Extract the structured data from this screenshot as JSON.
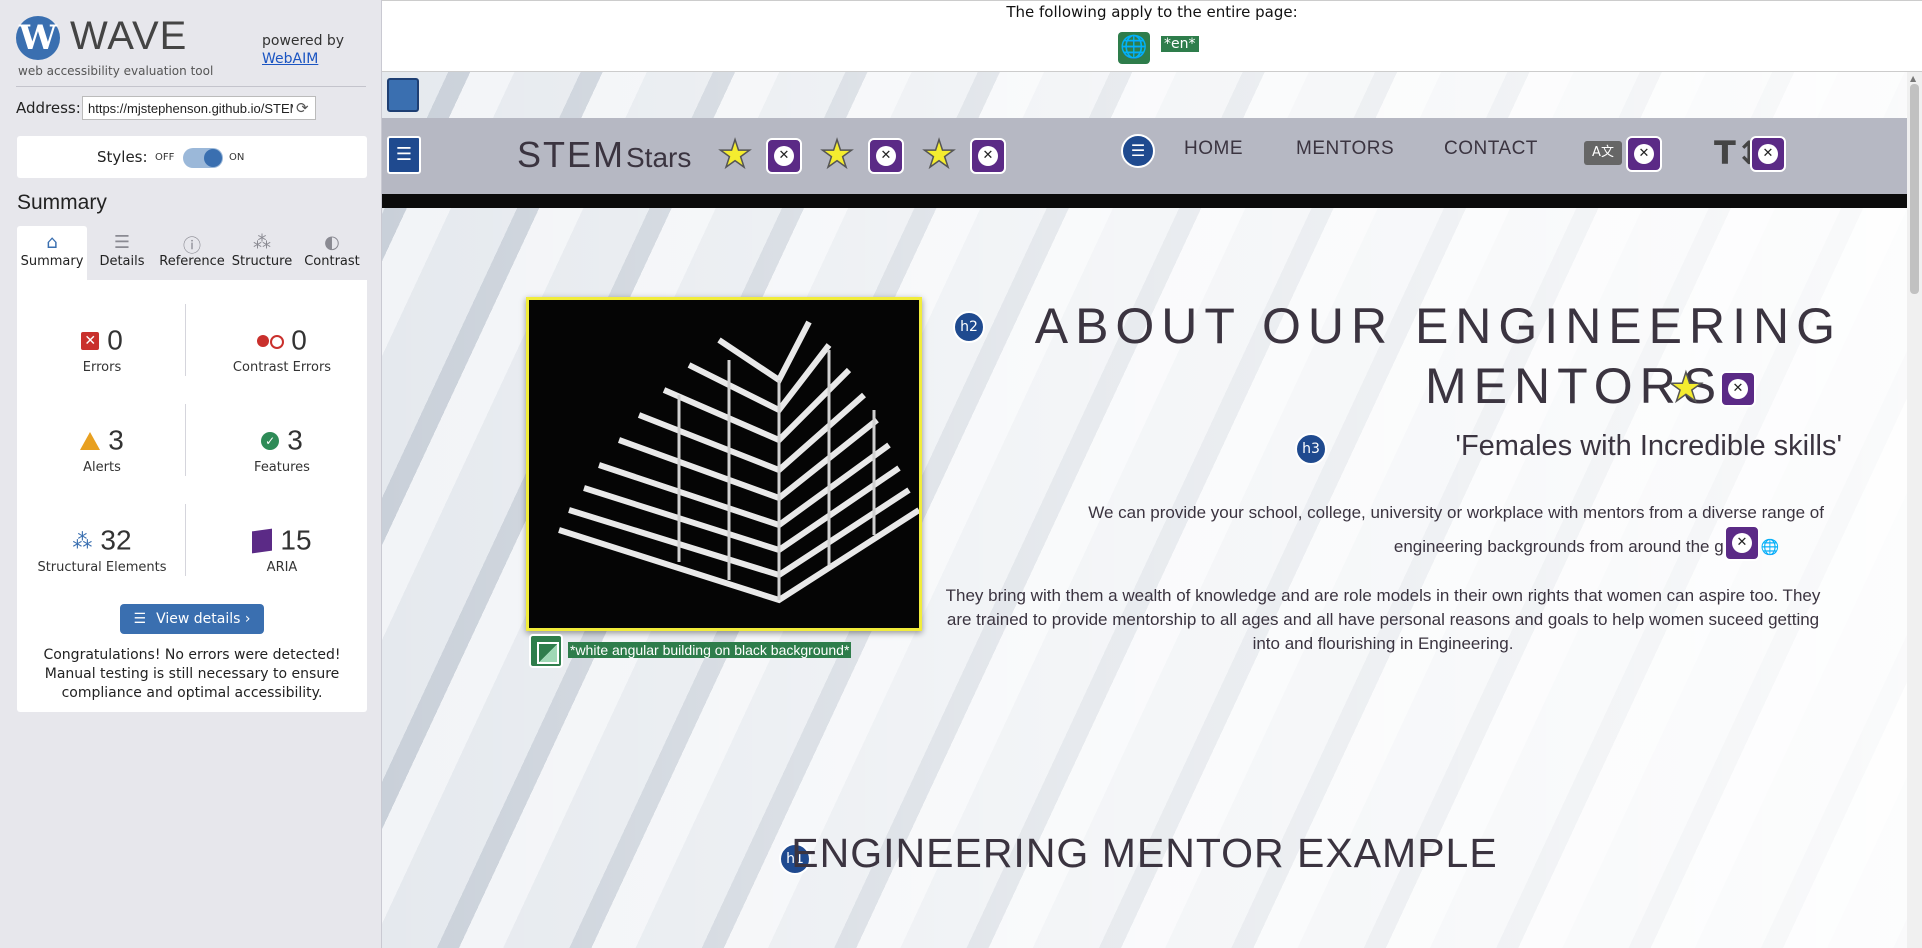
{
  "wave": {
    "logo_letter": "W",
    "title": "WAVE",
    "tagline": "web accessibility evaluation tool",
    "powered_by": "powered by",
    "powered_link": "WebAIM"
  },
  "address": {
    "label": "Address:",
    "value": "https://mjstephenson.github.io/STEM-Stars"
  },
  "styles": {
    "label": "Styles:",
    "off": "OFF",
    "on": "ON",
    "enabled": true
  },
  "summary_heading": "Summary",
  "tabs": [
    {
      "label": "Summary",
      "icon": "home-icon",
      "active": true
    },
    {
      "label": "Details",
      "icon": "list-icon"
    },
    {
      "label": "Reference",
      "icon": "info-icon"
    },
    {
      "label": "Structure",
      "icon": "structure-icon"
    },
    {
      "label": "Contrast",
      "icon": "contrast-icon"
    }
  ],
  "metrics": {
    "errors": {
      "value": "0",
      "label": "Errors"
    },
    "contrast_errors": {
      "value": "0",
      "label": "Contrast Errors"
    },
    "alerts": {
      "value": "3",
      "label": "Alerts"
    },
    "features": {
      "value": "3",
      "label": "Features"
    },
    "structural": {
      "value": "32",
      "label": "Structural Elements"
    },
    "aria": {
      "value": "15",
      "label": "ARIA"
    }
  },
  "view_details": "View details ›",
  "congrats": "Congratulations! No errors were detected! Manual testing is still necessary to ensure compliance and optimal accessibility.",
  "page": {
    "apply_text": "The following apply to the entire page:",
    "lang_tag": "*en*",
    "brand_stem": "STEM",
    "brand_stars": "Stars",
    "nav": [
      "HOME",
      "MENTORS",
      "CONTACT"
    ],
    "lang_btn": "A文",
    "textsize_btn": "T↕",
    "alt_text": "*white angular building on black background*",
    "h2_badge": "h2",
    "about_line1": "ABOUT OUR ENGINEERING",
    "about_line2": "MENTORS",
    "h3_badge": "h3",
    "subtitle": "'Females with Incredible skills'",
    "para1_line1": "We can provide your school, college, university or workplace with mentors from a diverse range of",
    "para1_line2": "engineering backgrounds from around the globe",
    "para2": "They bring with them a wealth of knowledge and are role models in their own rights that women can aspire too. They are trained to provide mentorship to all ages and all have personal reasons and goals to help women suceed getting into and flourishing in Engineering.",
    "h1_badge": "h1",
    "example_title": "ENGINEERING MENTOR EXAMPLE"
  },
  "colors": {
    "wave_blue": "#3a6fb0",
    "error_red": "#c9302c",
    "alert_orange": "#e8a020",
    "feature_green": "#2e7d4b",
    "aria_purple": "#5b2a86",
    "star_yellow": "#f4ec2f"
  }
}
